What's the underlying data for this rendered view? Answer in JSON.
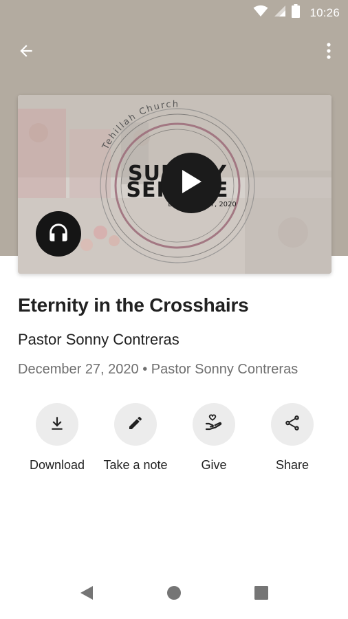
{
  "status_bar": {
    "time": "10:26",
    "icons": [
      "wifi-icon",
      "signal-icon",
      "battery-icon"
    ]
  },
  "app_bar": {
    "back_icon": "arrow-back-icon",
    "menu_icon": "more-vert-icon"
  },
  "media": {
    "artwork_text": {
      "church": "Tehillah Church",
      "line1": "SUNDAY",
      "line2": "SERVICE",
      "date": "December 27, 2020"
    },
    "play_icon": "play-icon",
    "audio_icon": "headphones-icon"
  },
  "sermon": {
    "title": "Eternity in the Crosshairs",
    "speaker": "Pastor Sonny Contreras",
    "meta": "December 27, 2020 • Pastor Sonny Contreras"
  },
  "actions": [
    {
      "label": "Download",
      "icon": "download-icon"
    },
    {
      "label": "Take a note",
      "icon": "pencil-icon"
    },
    {
      "label": "Give",
      "icon": "give-heart-hand-icon"
    },
    {
      "label": "Share",
      "icon": "share-icon"
    }
  ],
  "colors": {
    "header_bg": "#b3aba0",
    "accent_dark": "#1b1b1b",
    "action_circle": "#ececec",
    "meta_text": "#6f6f6f"
  }
}
